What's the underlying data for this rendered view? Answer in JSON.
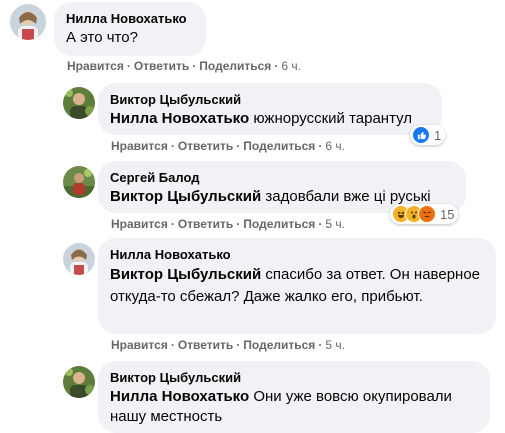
{
  "actions": {
    "like": "Нравится",
    "reply": "Ответить",
    "share": "Поделиться",
    "sep": "·"
  },
  "comments": [
    {
      "author": "Нилла Новохатько",
      "mention": "",
      "text": "А это что?",
      "time": "6 ч."
    },
    {
      "author": "Виктор Цыбульский",
      "mention": "Нилла Новохатько",
      "text": "южнорусский тарантул",
      "time": "6 ч.",
      "reactions": {
        "count": "1",
        "types": [
          "like-icon"
        ]
      }
    },
    {
      "author": "Сергей Балод",
      "mention": "Виктор Цыбульский",
      "text": "задовбали вже ці руські",
      "time": "5 ч.",
      "reactions": {
        "count": "15",
        "types": [
          "haha-icon",
          "wow-icon",
          "angry-icon"
        ]
      }
    },
    {
      "author": "Нилла Новохатько",
      "mention": "Виктор Цыбульский",
      "text": "спасибо за ответ. Он наверное откуда-то сбежал? Даже жалко его, прибьют.",
      "time": "5 ч."
    },
    {
      "author": "Виктор Цыбульский",
      "mention": "Нилла Новохатько",
      "text": "Они уже вовсю окупировали нашу местность",
      "time": ""
    }
  ],
  "colors": {
    "bubble": "#f0f2f5",
    "meta": "#65676b",
    "like": "#1877f2",
    "haha": "#f7b125",
    "angry": "#e9710f"
  }
}
